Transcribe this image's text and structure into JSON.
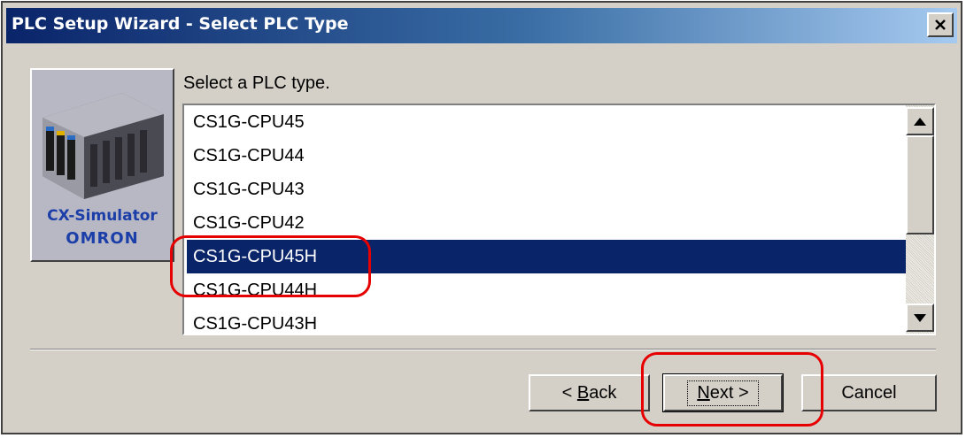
{
  "window": {
    "title": "PLC Setup Wizard - Select PLC Type",
    "colors": {
      "titlebar": "#0a246a",
      "face": "#d4d0c8",
      "selection": "#0a246a",
      "annotation": "#e60000"
    }
  },
  "logo": {
    "product": "CX-Simulator",
    "brand": "OMRON"
  },
  "prompt": "Select a PLC type.",
  "plc_list": {
    "items": [
      "CS1G-CPU45",
      "CS1G-CPU44",
      "CS1G-CPU43",
      "CS1G-CPU42",
      "CS1G-CPU45H",
      "CS1G-CPU44H",
      "CS1G-CPU43H"
    ],
    "selected": "CS1G-CPU45H"
  },
  "buttons": {
    "back": {
      "prefix": "< ",
      "mnemonic": "B",
      "rest": "ack"
    },
    "next": {
      "mnemonic": "N",
      "rest": "ext >"
    },
    "cancel": "Cancel"
  },
  "icons": {
    "close": "close-icon",
    "scroll_up": "arrow-up-icon",
    "scroll_down": "arrow-down-icon",
    "logo_art": "plc-rack-icon"
  }
}
